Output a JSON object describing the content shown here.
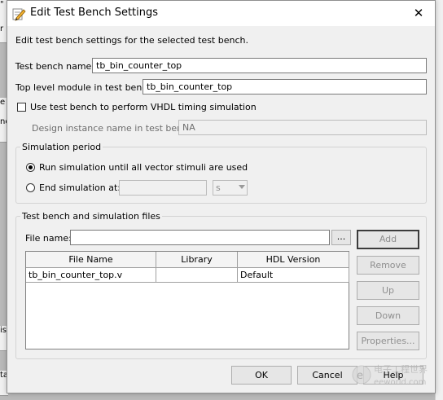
{
  "dialog": {
    "title": "Edit Test Bench Settings",
    "close_glyph": "✕",
    "description": "Edit test bench settings for the selected test bench."
  },
  "fields": {
    "test_bench_name_label": "Test bench name:",
    "test_bench_name_value": "tb_bin_counter_top",
    "top_level_label": "Top level module in test bench:",
    "top_level_value": "tb_bin_counter_top",
    "vhdl_timing_label": "Use test bench to perform VHDL timing simulation",
    "design_instance_label": "Design instance name in test bench:",
    "design_instance_value": "NA"
  },
  "simulation_period": {
    "title": "Simulation period",
    "run_all_label": "Run simulation until all vector stimuli are used",
    "end_at_label": "End simulation at:",
    "end_at_value": "",
    "unit_value": "s"
  },
  "files": {
    "title": "Test bench and simulation files",
    "file_name_label": "File name:",
    "file_name_value": "",
    "browse_label": "...",
    "columns": [
      "File Name",
      "Library",
      "HDL Version"
    ],
    "rows": [
      [
        "tb_bin_counter_top.v",
        "",
        "Default"
      ]
    ],
    "buttons": {
      "add": "Add",
      "remove": "Remove",
      "up": "Up",
      "down": "Down",
      "properties": "Properties..."
    }
  },
  "footer": {
    "ok": "OK",
    "cancel": "Cancel",
    "help": "Help"
  },
  "background_fragments": {
    "l1": "\"",
    "l2": "r",
    "l3": "e",
    "l4": "nc",
    "l5": "is",
    "l6": "ta"
  },
  "watermark": {
    "cn": "电子工程世界",
    "en": "eeworld.com"
  }
}
